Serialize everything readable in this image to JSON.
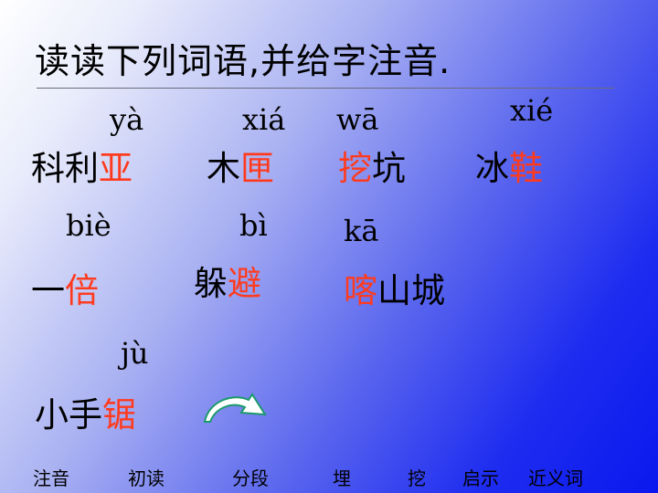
{
  "title": "读读下列词语,并给字注音.",
  "items": [
    {
      "pinyin": "yà",
      "prefix": "科利",
      "target": "亚",
      "suffix": ""
    },
    {
      "pinyin": "xiá",
      "prefix": "木",
      "target": "匣",
      "suffix": ""
    },
    {
      "pinyin": "wā",
      "prefix": "",
      "target": "挖",
      "suffix": "坑"
    },
    {
      "pinyin": "xié",
      "prefix": "冰",
      "target": "鞋",
      "suffix": ""
    },
    {
      "pinyin": "biè",
      "prefix": "一",
      "target": "倍",
      "suffix": ""
    },
    {
      "pinyin": "bì",
      "prefix": "躲",
      "target": "避",
      "suffix": ""
    },
    {
      "pinyin": "kā",
      "prefix": "",
      "target": "喀",
      "suffix": "山城"
    },
    {
      "pinyin": "jù",
      "prefix": "小手",
      "target": "锯",
      "suffix": ""
    }
  ],
  "nav": [
    "注音",
    "初读",
    "分段",
    "埋",
    "挖",
    "启示",
    "近义词"
  ],
  "colors": {
    "highlight": "#ff3b1f",
    "arrow": "#1a9a6a"
  },
  "icons": {
    "back": "curved-arrow-icon"
  }
}
